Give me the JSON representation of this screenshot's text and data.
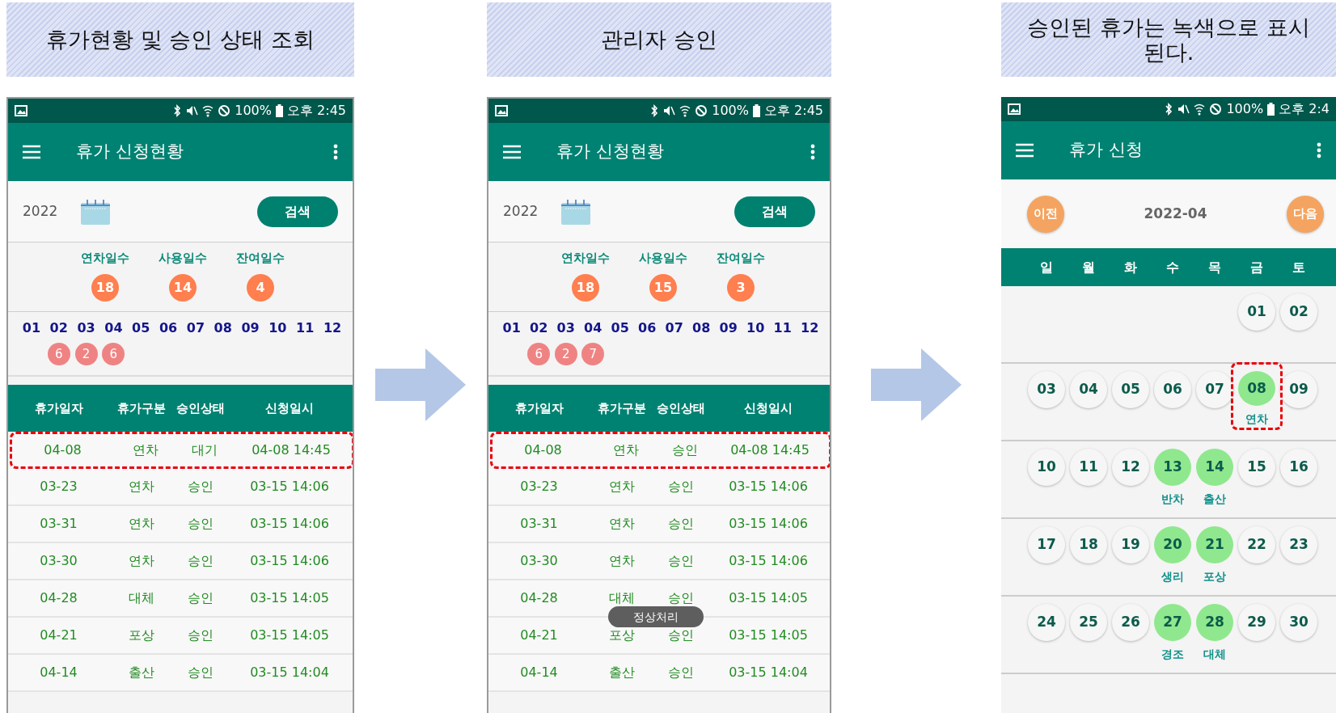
{
  "panels": [
    {
      "caption": "휴가현황 및 승인 상태 조회",
      "phone": {
        "kind": "list",
        "status_bar": {
          "battery": "100%",
          "time": "오후 2:45"
        },
        "app_bar": {
          "title": "휴가 신청현황"
        },
        "search": {
          "year": "2022",
          "button": "검색"
        },
        "stats": [
          {
            "label": "연차일수",
            "value": "18"
          },
          {
            "label": "사용일수",
            "value": "14"
          },
          {
            "label": "잔여일수",
            "value": "4"
          }
        ],
        "months": [
          {
            "label": "01"
          },
          {
            "label": "02",
            "badge": "6"
          },
          {
            "label": "03",
            "badge": "2"
          },
          {
            "label": "04",
            "badge": "6"
          },
          {
            "label": "05"
          },
          {
            "label": "06"
          },
          {
            "label": "07"
          },
          {
            "label": "08"
          },
          {
            "label": "09"
          },
          {
            "label": "10"
          },
          {
            "label": "11"
          },
          {
            "label": "12"
          }
        ],
        "table": {
          "columns": [
            "휴가일자",
            "휴가구분",
            "승인상태",
            "신청일시"
          ],
          "rows": [
            {
              "date": "04-08",
              "type": "연차",
              "status": "대기",
              "requested": "04-08 14:45",
              "highlighted": true
            },
            {
              "date": "03-23",
              "type": "연차",
              "status": "승인",
              "requested": "03-15 14:06",
              "highlighted": false
            },
            {
              "date": "03-31",
              "type": "연차",
              "status": "승인",
              "requested": "03-15 14:06",
              "highlighted": false
            },
            {
              "date": "03-30",
              "type": "연차",
              "status": "승인",
              "requested": "03-15 14:06",
              "highlighted": false
            },
            {
              "date": "04-28",
              "type": "대체",
              "status": "승인",
              "requested": "03-15 14:05",
              "highlighted": false
            },
            {
              "date": "04-21",
              "type": "포상",
              "status": "승인",
              "requested": "03-15 14:05",
              "highlighted": false
            },
            {
              "date": "04-14",
              "type": "출산",
              "status": "승인",
              "requested": "03-15 14:04",
              "highlighted": false
            }
          ]
        }
      }
    },
    {
      "caption": "관리자 승인",
      "phone": {
        "kind": "list",
        "status_bar": {
          "battery": "100%",
          "time": "오후 2:45"
        },
        "app_bar": {
          "title": "휴가 신청현황"
        },
        "search": {
          "year": "2022",
          "button": "검색"
        },
        "stats": [
          {
            "label": "연차일수",
            "value": "18"
          },
          {
            "label": "사용일수",
            "value": "15"
          },
          {
            "label": "잔여일수",
            "value": "3"
          }
        ],
        "months": [
          {
            "label": "01"
          },
          {
            "label": "02",
            "badge": "6"
          },
          {
            "label": "03",
            "badge": "2"
          },
          {
            "label": "04",
            "badge": "7"
          },
          {
            "label": "05"
          },
          {
            "label": "06"
          },
          {
            "label": "07"
          },
          {
            "label": "08"
          },
          {
            "label": "09"
          },
          {
            "label": "10"
          },
          {
            "label": "11"
          },
          {
            "label": "12"
          }
        ],
        "table": {
          "columns": [
            "휴가일자",
            "휴가구분",
            "승인상태",
            "신청일시"
          ],
          "rows": [
            {
              "date": "04-08",
              "type": "연차",
              "status": "승인",
              "requested": "04-08 14:45",
              "highlighted": true
            },
            {
              "date": "03-23",
              "type": "연차",
              "status": "승인",
              "requested": "03-15 14:06",
              "highlighted": false
            },
            {
              "date": "03-31",
              "type": "연차",
              "status": "승인",
              "requested": "03-15 14:06",
              "highlighted": false
            },
            {
              "date": "03-30",
              "type": "연차",
              "status": "승인",
              "requested": "03-15 14:06",
              "highlighted": false
            },
            {
              "date": "04-28",
              "type": "대체",
              "status": "승인",
              "requested": "03-15 14:05",
              "highlighted": false
            },
            {
              "date": "04-21",
              "type": "포상",
              "status": "승인",
              "requested": "03-15 14:05",
              "highlighted": false
            },
            {
              "date": "04-14",
              "type": "출산",
              "status": "승인",
              "requested": "03-15 14:04",
              "highlighted": false
            }
          ]
        },
        "toast": "정상처리"
      }
    },
    {
      "caption": "승인된 휴가는 녹색으로 표시된다.",
      "phone": {
        "kind": "calendar",
        "status_bar": {
          "battery": "100%",
          "time": "오후 2:4"
        },
        "app_bar": {
          "title": "휴가 신청"
        },
        "nav": {
          "prev": "이전",
          "month": "2022-04",
          "next": "다음"
        },
        "weekdays": [
          "일",
          "월",
          "화",
          "수",
          "목",
          "금",
          "토"
        ],
        "weeks": [
          [
            {
              "kind": "blank"
            },
            {
              "kind": "blank"
            },
            {
              "kind": "blank"
            },
            {
              "kind": "blank"
            },
            {
              "kind": "blank"
            },
            {
              "day": "01",
              "approved": false,
              "highlighted": false
            },
            {
              "day": "02",
              "approved": false,
              "highlighted": false
            }
          ],
          [
            {
              "day": "03",
              "approved": false,
              "highlighted": false
            },
            {
              "day": "04",
              "approved": false,
              "highlighted": false
            },
            {
              "day": "05",
              "approved": false,
              "highlighted": false
            },
            {
              "day": "06",
              "approved": false,
              "highlighted": false
            },
            {
              "day": "07",
              "approved": false,
              "highlighted": false
            },
            {
              "day": "08",
              "approved": true,
              "leave": "연차",
              "highlighted": true
            },
            {
              "day": "09",
              "approved": false,
              "highlighted": false
            }
          ],
          [
            {
              "day": "10",
              "approved": false,
              "highlighted": false
            },
            {
              "day": "11",
              "approved": false,
              "highlighted": false
            },
            {
              "day": "12",
              "approved": false,
              "highlighted": false
            },
            {
              "day": "13",
              "approved": true,
              "leave": "반차",
              "highlighted": false
            },
            {
              "day": "14",
              "approved": true,
              "leave": "출산",
              "highlighted": false
            },
            {
              "day": "15",
              "approved": false,
              "highlighted": false
            },
            {
              "day": "16",
              "approved": false,
              "highlighted": false
            }
          ],
          [
            {
              "day": "17",
              "approved": false,
              "highlighted": false
            },
            {
              "day": "18",
              "approved": false,
              "highlighted": false
            },
            {
              "day": "19",
              "approved": false,
              "highlighted": false
            },
            {
              "day": "20",
              "approved": true,
              "leave": "생리",
              "highlighted": false
            },
            {
              "day": "21",
              "approved": true,
              "leave": "포상",
              "highlighted": false
            },
            {
              "day": "22",
              "approved": false,
              "highlighted": false
            },
            {
              "day": "23",
              "approved": false,
              "highlighted": false
            }
          ],
          [
            {
              "day": "24",
              "approved": false,
              "highlighted": false
            },
            {
              "day": "25",
              "approved": false,
              "highlighted": false
            },
            {
              "day": "26",
              "approved": false,
              "highlighted": false
            },
            {
              "day": "27",
              "approved": true,
              "leave": "경조",
              "highlighted": false
            },
            {
              "day": "28",
              "approved": true,
              "leave": "대체",
              "highlighted": false
            },
            {
              "day": "29",
              "approved": false,
              "highlighted": false
            },
            {
              "day": "30",
              "approved": false,
              "highlighted": false
            }
          ]
        ]
      }
    }
  ]
}
